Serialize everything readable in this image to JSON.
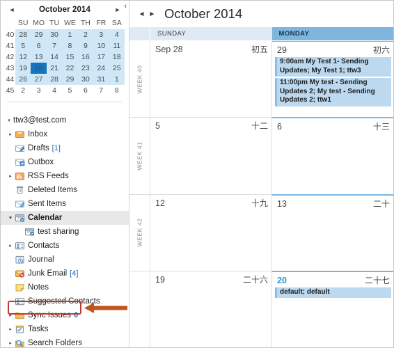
{
  "mini_calendar": {
    "prev_label": "◄",
    "next_label": "►",
    "title": "October 2014",
    "collapse_label": "‹",
    "week_corner": "",
    "dow": [
      "SU",
      "MO",
      "TU",
      "WE",
      "TH",
      "FR",
      "SA"
    ],
    "weeks": [
      {
        "num": "40",
        "days": [
          {
            "d": "28",
            "state": "in",
            "bold": false
          },
          {
            "d": "29",
            "state": "in",
            "bold": true
          },
          {
            "d": "30",
            "state": "in",
            "bold": true
          },
          {
            "d": "1",
            "state": "in",
            "bold": true
          },
          {
            "d": "2",
            "state": "in",
            "bold": false
          },
          {
            "d": "3",
            "state": "in",
            "bold": true
          },
          {
            "d": "4",
            "state": "in",
            "bold": false
          }
        ]
      },
      {
        "num": "41",
        "days": [
          {
            "d": "5",
            "state": "in",
            "bold": false
          },
          {
            "d": "6",
            "state": "in",
            "bold": false
          },
          {
            "d": "7",
            "state": "in",
            "bold": false
          },
          {
            "d": "8",
            "state": "in",
            "bold": false
          },
          {
            "d": "9",
            "state": "in",
            "bold": false
          },
          {
            "d": "10",
            "state": "in",
            "bold": false
          },
          {
            "d": "11",
            "state": "in",
            "bold": false
          }
        ]
      },
      {
        "num": "42",
        "days": [
          {
            "d": "12",
            "state": "in",
            "bold": false
          },
          {
            "d": "13",
            "state": "in",
            "bold": false
          },
          {
            "d": "14",
            "state": "in",
            "bold": false
          },
          {
            "d": "15",
            "state": "in",
            "bold": true
          },
          {
            "d": "16",
            "state": "in",
            "bold": false
          },
          {
            "d": "17",
            "state": "in",
            "bold": true
          },
          {
            "d": "18",
            "state": "in",
            "bold": false
          }
        ]
      },
      {
        "num": "43",
        "days": [
          {
            "d": "19",
            "state": "in",
            "bold": false
          },
          {
            "d": "20",
            "state": "today",
            "bold": true
          },
          {
            "d": "21",
            "state": "in",
            "bold": false
          },
          {
            "d": "22",
            "state": "in",
            "bold": false
          },
          {
            "d": "23",
            "state": "in",
            "bold": false
          },
          {
            "d": "24",
            "state": "in",
            "bold": false
          },
          {
            "d": "25",
            "state": "in",
            "bold": false
          }
        ]
      },
      {
        "num": "44",
        "days": [
          {
            "d": "26",
            "state": "in",
            "bold": false
          },
          {
            "d": "27",
            "state": "in",
            "bold": true
          },
          {
            "d": "28",
            "state": "in",
            "bold": false
          },
          {
            "d": "29",
            "state": "in",
            "bold": true
          },
          {
            "d": "30",
            "state": "in",
            "bold": false
          },
          {
            "d": "31",
            "state": "in",
            "bold": true
          },
          {
            "d": "1",
            "state": "in",
            "bold": true
          }
        ]
      },
      {
        "num": "45",
        "days": [
          {
            "d": "2",
            "state": "out",
            "bold": false
          },
          {
            "d": "3",
            "state": "out",
            "bold": false
          },
          {
            "d": "4",
            "state": "out",
            "bold": false
          },
          {
            "d": "5",
            "state": "out",
            "bold": false
          },
          {
            "d": "6",
            "state": "out",
            "bold": false
          },
          {
            "d": "7",
            "state": "out",
            "bold": false
          },
          {
            "d": "8",
            "state": "out",
            "bold": false
          }
        ]
      }
    ]
  },
  "folders": {
    "account": "ttw3@test.com",
    "items": [
      {
        "label": "Inbox",
        "icon": "inbox-icon",
        "expand": true,
        "indent": 0,
        "count": "",
        "selected": false
      },
      {
        "label": "Drafts",
        "icon": "drafts-icon",
        "expand": false,
        "indent": 0,
        "count": "[1]",
        "selected": false
      },
      {
        "label": "Outbox",
        "icon": "outbox-icon",
        "expand": false,
        "indent": 0,
        "count": "",
        "selected": false
      },
      {
        "label": "RSS Feeds",
        "icon": "rss-icon",
        "expand": true,
        "indent": 0,
        "count": "",
        "selected": false
      },
      {
        "label": "Deleted Items",
        "icon": "trash-icon",
        "expand": false,
        "indent": 0,
        "count": "",
        "selected": false
      },
      {
        "label": "Sent Items",
        "icon": "sent-icon",
        "expand": false,
        "indent": 0,
        "count": "",
        "selected": false
      },
      {
        "label": "Calendar",
        "icon": "calendar-icon",
        "expand": true,
        "indent": 0,
        "count": "",
        "selected": true
      },
      {
        "label": "test sharing",
        "icon": "calendar-icon",
        "expand": false,
        "indent": 1,
        "count": "",
        "selected": false
      },
      {
        "label": "Contacts",
        "icon": "contacts-icon",
        "expand": true,
        "indent": 0,
        "count": "",
        "selected": false
      },
      {
        "label": "Journal",
        "icon": "journal-icon",
        "expand": false,
        "indent": 0,
        "count": "",
        "selected": false
      },
      {
        "label": "Junk Email",
        "icon": "junk-icon",
        "expand": false,
        "indent": 0,
        "count": "[4]",
        "selected": false
      },
      {
        "label": "Notes",
        "icon": "notes-icon",
        "expand": false,
        "indent": 0,
        "count": "",
        "selected": false
      },
      {
        "label": "Suggested Contacts",
        "icon": "contacts-icon",
        "expand": false,
        "indent": 0,
        "count": "",
        "selected": false
      },
      {
        "label": "Sync Issues",
        "icon": "folder-icon",
        "expand": true,
        "indent": 0,
        "count": "6",
        "selected": false
      },
      {
        "label": "Tasks",
        "icon": "tasks-icon",
        "expand": true,
        "indent": 0,
        "count": "",
        "selected": false
      },
      {
        "label": "Search Folders",
        "icon": "search-icon",
        "expand": true,
        "indent": 0,
        "count": "",
        "selected": false
      }
    ]
  },
  "annotation": {
    "highlight_target": "Deleted Items",
    "box_color": "#c0392b",
    "arrow_color": "#c0561f"
  },
  "calendar": {
    "prev_label": "◄",
    "next_label": "►",
    "title": "October 2014",
    "day_headers": [
      {
        "label": "SUNDAY",
        "active": false
      },
      {
        "label": "MONDAY",
        "active": true
      }
    ],
    "weeks": [
      {
        "week_label": "WEEK 40",
        "days": [
          {
            "num": "Sep 28",
            "lunar": "初五",
            "today": false,
            "selected_col": false,
            "appointments": []
          },
          {
            "num": "29",
            "lunar": "初六",
            "today": false,
            "selected_col": true,
            "appointments": [
              "9:00am My Test 1- Sending Updates; My Test 1; ttw3",
              "11:00pm My test - Sending Updates 2; My test - Sending Updates 2; ttw1"
            ]
          }
        ]
      },
      {
        "week_label": "WEEK 41",
        "days": [
          {
            "num": "5",
            "lunar": "十二",
            "today": false,
            "selected_col": false,
            "appointments": []
          },
          {
            "num": "6",
            "lunar": "十三",
            "today": false,
            "selected_col": true,
            "appointments": []
          }
        ]
      },
      {
        "week_label": "WEEK 42",
        "days": [
          {
            "num": "12",
            "lunar": "十九",
            "today": false,
            "selected_col": false,
            "appointments": []
          },
          {
            "num": "13",
            "lunar": "二十",
            "today": false,
            "selected_col": true,
            "appointments": []
          }
        ]
      },
      {
        "week_label": "",
        "days": [
          {
            "num": "19",
            "lunar": "二十六",
            "today": false,
            "selected_col": false,
            "appointments": []
          },
          {
            "num": "20",
            "lunar": "二十七",
            "today": true,
            "selected_col": true,
            "appointments": [
              "default; default"
            ]
          }
        ]
      }
    ]
  }
}
